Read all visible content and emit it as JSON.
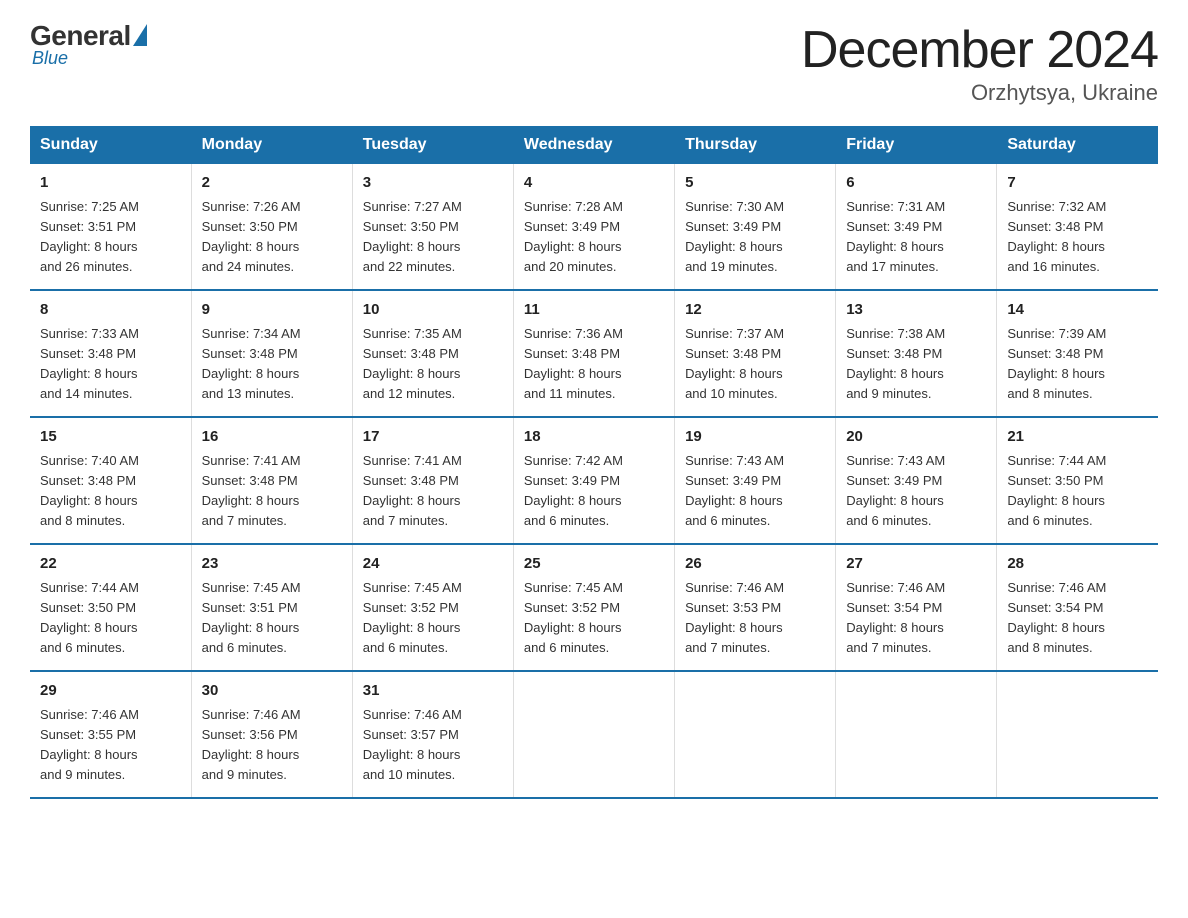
{
  "logo": {
    "general": "General",
    "blue": "Blue",
    "tagline": "Blue"
  },
  "header": {
    "month": "December 2024",
    "location": "Orzhytsya, Ukraine"
  },
  "days_header": [
    "Sunday",
    "Monday",
    "Tuesday",
    "Wednesday",
    "Thursday",
    "Friday",
    "Saturday"
  ],
  "weeks": [
    [
      {
        "num": "1",
        "info": "Sunrise: 7:25 AM\nSunset: 3:51 PM\nDaylight: 8 hours\nand 26 minutes."
      },
      {
        "num": "2",
        "info": "Sunrise: 7:26 AM\nSunset: 3:50 PM\nDaylight: 8 hours\nand 24 minutes."
      },
      {
        "num": "3",
        "info": "Sunrise: 7:27 AM\nSunset: 3:50 PM\nDaylight: 8 hours\nand 22 minutes."
      },
      {
        "num": "4",
        "info": "Sunrise: 7:28 AM\nSunset: 3:49 PM\nDaylight: 8 hours\nand 20 minutes."
      },
      {
        "num": "5",
        "info": "Sunrise: 7:30 AM\nSunset: 3:49 PM\nDaylight: 8 hours\nand 19 minutes."
      },
      {
        "num": "6",
        "info": "Sunrise: 7:31 AM\nSunset: 3:49 PM\nDaylight: 8 hours\nand 17 minutes."
      },
      {
        "num": "7",
        "info": "Sunrise: 7:32 AM\nSunset: 3:48 PM\nDaylight: 8 hours\nand 16 minutes."
      }
    ],
    [
      {
        "num": "8",
        "info": "Sunrise: 7:33 AM\nSunset: 3:48 PM\nDaylight: 8 hours\nand 14 minutes."
      },
      {
        "num": "9",
        "info": "Sunrise: 7:34 AM\nSunset: 3:48 PM\nDaylight: 8 hours\nand 13 minutes."
      },
      {
        "num": "10",
        "info": "Sunrise: 7:35 AM\nSunset: 3:48 PM\nDaylight: 8 hours\nand 12 minutes."
      },
      {
        "num": "11",
        "info": "Sunrise: 7:36 AM\nSunset: 3:48 PM\nDaylight: 8 hours\nand 11 minutes."
      },
      {
        "num": "12",
        "info": "Sunrise: 7:37 AM\nSunset: 3:48 PM\nDaylight: 8 hours\nand 10 minutes."
      },
      {
        "num": "13",
        "info": "Sunrise: 7:38 AM\nSunset: 3:48 PM\nDaylight: 8 hours\nand 9 minutes."
      },
      {
        "num": "14",
        "info": "Sunrise: 7:39 AM\nSunset: 3:48 PM\nDaylight: 8 hours\nand 8 minutes."
      }
    ],
    [
      {
        "num": "15",
        "info": "Sunrise: 7:40 AM\nSunset: 3:48 PM\nDaylight: 8 hours\nand 8 minutes."
      },
      {
        "num": "16",
        "info": "Sunrise: 7:41 AM\nSunset: 3:48 PM\nDaylight: 8 hours\nand 7 minutes."
      },
      {
        "num": "17",
        "info": "Sunrise: 7:41 AM\nSunset: 3:48 PM\nDaylight: 8 hours\nand 7 minutes."
      },
      {
        "num": "18",
        "info": "Sunrise: 7:42 AM\nSunset: 3:49 PM\nDaylight: 8 hours\nand 6 minutes."
      },
      {
        "num": "19",
        "info": "Sunrise: 7:43 AM\nSunset: 3:49 PM\nDaylight: 8 hours\nand 6 minutes."
      },
      {
        "num": "20",
        "info": "Sunrise: 7:43 AM\nSunset: 3:49 PM\nDaylight: 8 hours\nand 6 minutes."
      },
      {
        "num": "21",
        "info": "Sunrise: 7:44 AM\nSunset: 3:50 PM\nDaylight: 8 hours\nand 6 minutes."
      }
    ],
    [
      {
        "num": "22",
        "info": "Sunrise: 7:44 AM\nSunset: 3:50 PM\nDaylight: 8 hours\nand 6 minutes."
      },
      {
        "num": "23",
        "info": "Sunrise: 7:45 AM\nSunset: 3:51 PM\nDaylight: 8 hours\nand 6 minutes."
      },
      {
        "num": "24",
        "info": "Sunrise: 7:45 AM\nSunset: 3:52 PM\nDaylight: 8 hours\nand 6 minutes."
      },
      {
        "num": "25",
        "info": "Sunrise: 7:45 AM\nSunset: 3:52 PM\nDaylight: 8 hours\nand 6 minutes."
      },
      {
        "num": "26",
        "info": "Sunrise: 7:46 AM\nSunset: 3:53 PM\nDaylight: 8 hours\nand 7 minutes."
      },
      {
        "num": "27",
        "info": "Sunrise: 7:46 AM\nSunset: 3:54 PM\nDaylight: 8 hours\nand 7 minutes."
      },
      {
        "num": "28",
        "info": "Sunrise: 7:46 AM\nSunset: 3:54 PM\nDaylight: 8 hours\nand 8 minutes."
      }
    ],
    [
      {
        "num": "29",
        "info": "Sunrise: 7:46 AM\nSunset: 3:55 PM\nDaylight: 8 hours\nand 9 minutes."
      },
      {
        "num": "30",
        "info": "Sunrise: 7:46 AM\nSunset: 3:56 PM\nDaylight: 8 hours\nand 9 minutes."
      },
      {
        "num": "31",
        "info": "Sunrise: 7:46 AM\nSunset: 3:57 PM\nDaylight: 8 hours\nand 10 minutes."
      },
      {
        "num": "",
        "info": ""
      },
      {
        "num": "",
        "info": ""
      },
      {
        "num": "",
        "info": ""
      },
      {
        "num": "",
        "info": ""
      }
    ]
  ]
}
